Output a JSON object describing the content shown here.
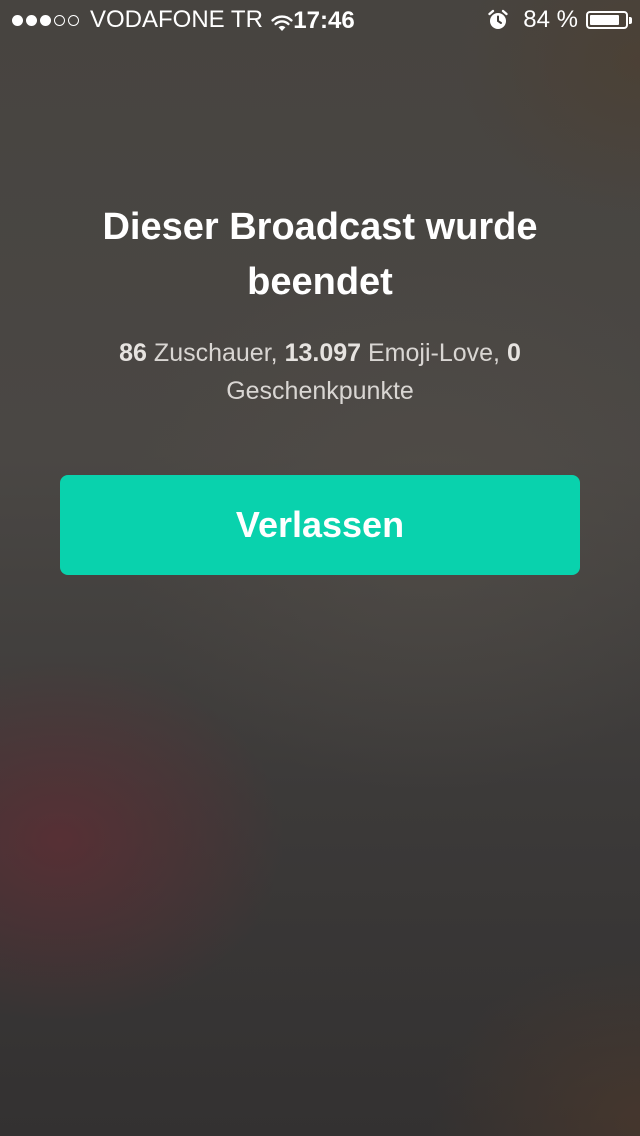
{
  "status_bar": {
    "signal_dots_filled": 3,
    "signal_dots_total": 5,
    "carrier": "VODAFONE TR",
    "time": "17:46",
    "battery_percent_text": "84 %",
    "battery_level": 0.84,
    "icons": [
      "signal-dots",
      "wifi-icon",
      "alarm-icon",
      "battery-icon"
    ]
  },
  "broadcast_end": {
    "title": "Dieser Broadcast wurde beendet",
    "stats": {
      "viewers_count": "86",
      "viewers_label": "Zuschauer,",
      "emoji_love_count": "13.097",
      "emoji_love_label": "Emoji-Love,",
      "gift_points_count": "0",
      "gift_points_label": "Geschenkpunkte"
    },
    "leave_button_label": "Verlassen"
  },
  "colors": {
    "accent": "#09d2ad",
    "text_primary": "#ffffff",
    "text_secondary": "#d9d6d3"
  }
}
